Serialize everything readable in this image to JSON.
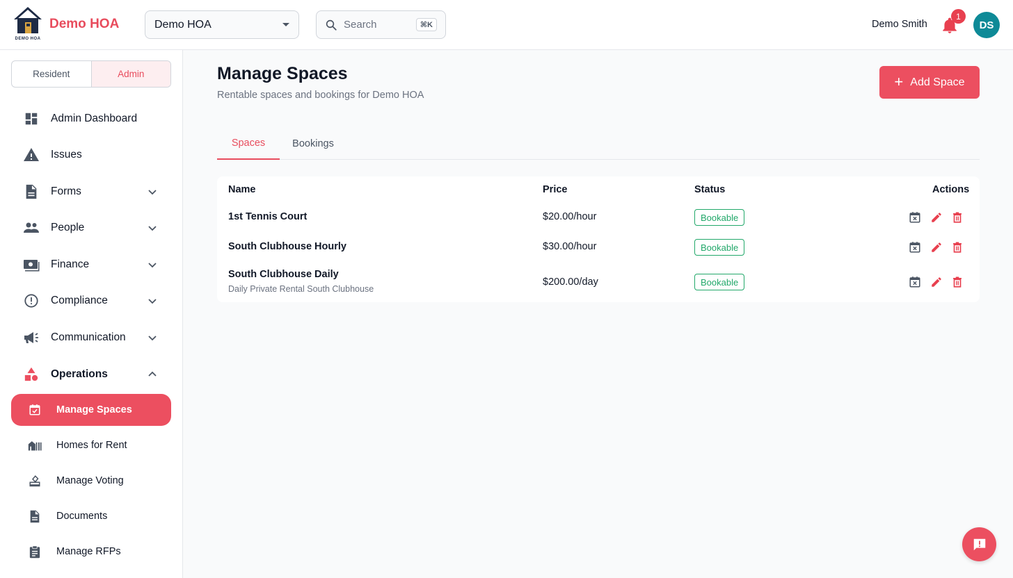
{
  "colors": {
    "accent": "#ec4f60",
    "success": "#22a86a",
    "avatar": "#0e8a97",
    "logo": "#1e2b45"
  },
  "header": {
    "brand": "Demo HOA",
    "logo_caption": "DEMO HOA",
    "hoa_select": {
      "value": "Demo HOA"
    },
    "search": {
      "placeholder": "Search",
      "shortcut": "⌘K"
    },
    "user_name": "Demo Smith",
    "notification_count": "1",
    "avatar_initials": "DS"
  },
  "sidebar": {
    "roles": [
      "Resident",
      "Admin"
    ],
    "active_role": "Admin",
    "items": [
      {
        "label": "Admin Dashboard",
        "icon": "dashboard-icon"
      },
      {
        "label": "Issues",
        "icon": "warning-icon"
      },
      {
        "label": "Forms",
        "icon": "document-icon"
      },
      {
        "label": "People",
        "icon": "people-icon"
      },
      {
        "label": "Finance",
        "icon": "money-icon"
      },
      {
        "label": "Compliance",
        "icon": "alert-circle-icon"
      },
      {
        "label": "Communication",
        "icon": "megaphone-icon"
      },
      {
        "label": "Operations",
        "icon": "shapes-icon"
      }
    ],
    "sub_items": [
      {
        "label": "Manage Spaces",
        "icon": "calendar-check-icon",
        "active": true
      },
      {
        "label": "Homes for Rent",
        "icon": "homes-icon"
      },
      {
        "label": "Manage Voting",
        "icon": "ballot-icon"
      },
      {
        "label": "Documents",
        "icon": "document-icon"
      },
      {
        "label": "Manage RFPs",
        "icon": "clipboard-icon"
      }
    ]
  },
  "main": {
    "title": "Manage Spaces",
    "subtitle": "Rentable spaces and bookings for Demo HOA",
    "add_button": "Add Space",
    "tabs": [
      "Spaces",
      "Bookings"
    ],
    "active_tab": "Spaces",
    "table": {
      "headers": [
        "Name",
        "Price",
        "Status",
        "Actions"
      ],
      "rows": [
        {
          "name": "1st Tennis Court",
          "description": "",
          "price": "$20.00/hour",
          "status": "Bookable"
        },
        {
          "name": "South Clubhouse Hourly",
          "description": "",
          "price": "$30.00/hour",
          "status": "Bookable"
        },
        {
          "name": "South Clubhouse Daily",
          "description": "Daily Private Rental South Clubhouse",
          "price": "$200.00/day",
          "status": "Bookable"
        }
      ]
    }
  }
}
